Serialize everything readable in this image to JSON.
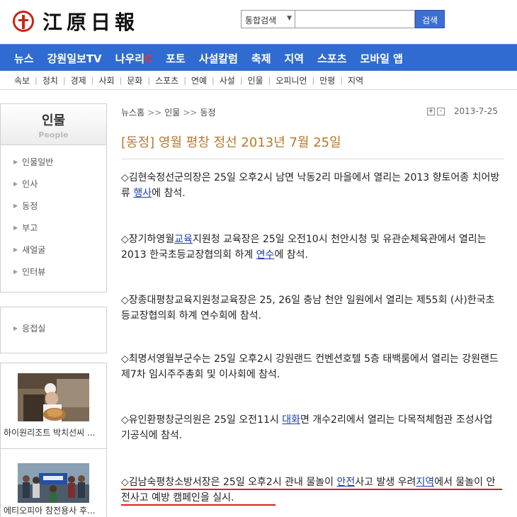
{
  "header": {
    "logo_text": "江原日報",
    "search": {
      "scope": "통합검색",
      "value": "",
      "button": "검색"
    }
  },
  "mainnav": {
    "items": [
      "뉴스",
      "강원일보TV",
      "나우리",
      "포토",
      "사설칼럼",
      "축제",
      "지역",
      "스포츠",
      "모바일 앱"
    ],
    "now_c": "C"
  },
  "subnav": {
    "items": [
      "속보",
      "정치",
      "경제",
      "사회",
      "문화",
      "스포츠",
      "연예",
      "사설",
      "인물",
      "오피니언",
      "만평",
      "지역"
    ]
  },
  "sidebar": {
    "title": "인물",
    "subtitle": "People",
    "items": [
      "인물일반",
      "인사",
      "동정",
      "부고",
      "새얼굴",
      "인터뷰"
    ],
    "extra": "응접실",
    "thumbs": [
      {
        "caption": "하이원리조트 박치선씨 ..."
      },
      {
        "caption": "에티오피아 참전용사 후..."
      }
    ]
  },
  "article": {
    "breadcrumb": [
      "뉴스홈",
      "인물",
      "동정"
    ],
    "breadcrumb_sep": ">>",
    "zoom_in": "+",
    "zoom_out": "-",
    "date": "2013-7-25",
    "title": "[동정] 영월 평창 정선 2013년 7월 25일",
    "p1": {
      "a": "◇김현숙정선군의장은 25일 오후2시 남면 낙동2리 마을에서 열리는 2013 향토어종 치어방류 ",
      "link": "행사",
      "b": "에 참석."
    },
    "p2": {
      "a": "◇장기하영월",
      "link1": "교육",
      "b": "지원청 교육장은 25일 오전10시 천안시청 및 유관순체육관에서 열리는 2013 한국초등교장협의회 하계 ",
      "link2": "연수",
      "c": "에 참석."
    },
    "p3": "◇장종대평창교육지원청교육장은 25, 26일 충남 천안 일원에서 열리는 제55회 (사)한국초등교장협의회 하계 연수회에 참석.",
    "p4": "◇최명서영월부군수는 25일 오후2시 강원랜드 컨벤션호텔 5층 태백룸에서 열리는 강원랜드 제7차 임시주주총회 및 이사회에 참석.",
    "p5": {
      "a": "◇유인환평창군의원은 25일 오전11시 ",
      "link": "대화",
      "b": "면 개수2리에서 열리는 다목적체험관 조성사업 기공식에 참석."
    },
    "p6": {
      "a": "◇김남숙평창소방서장은 25일 오후2시 관내 물놀이 ",
      "link1": "안전",
      "b": "사고 발생 우려",
      "link2": "지역",
      "c": "에서 물놀이 안전사고 예방 캠페인을 실시."
    }
  },
  "colors": {
    "nav_blue": "#2f6bd0",
    "title_brown": "#b7792b",
    "link_blue": "#1a3fa6",
    "underline_red": "#d9211f",
    "logo_red": "#c8261b"
  }
}
